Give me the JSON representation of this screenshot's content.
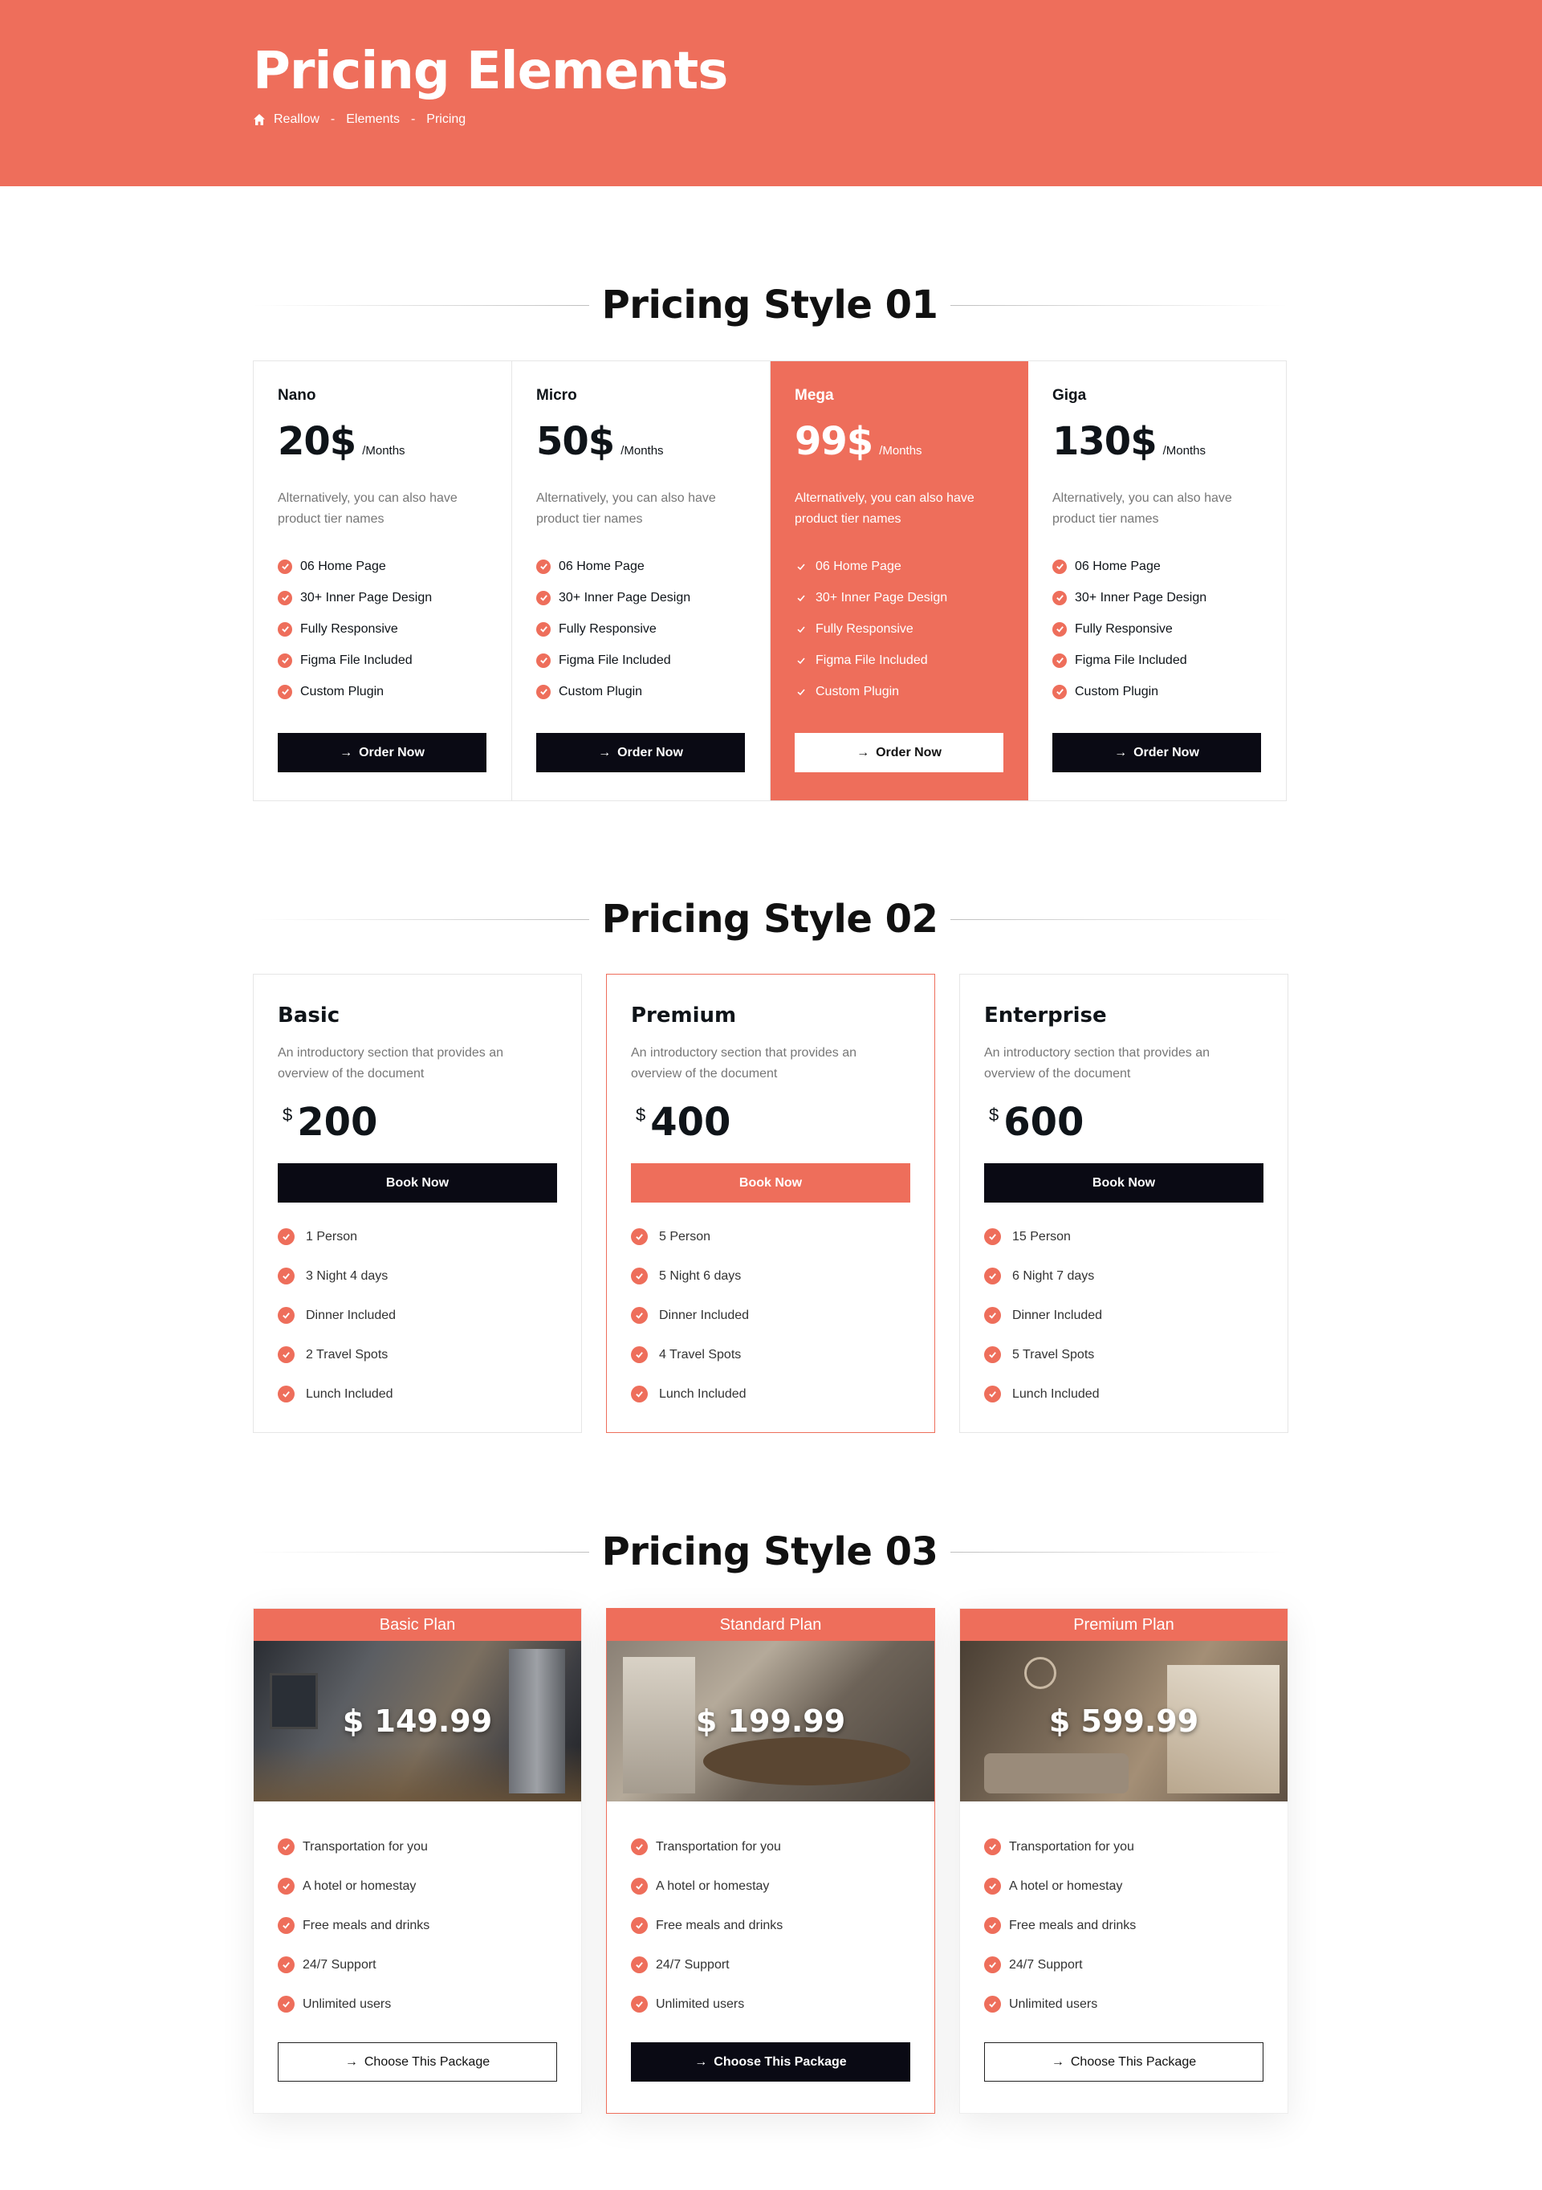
{
  "hero": {
    "title": "Pricing Elements",
    "breadcrumb": [
      "Reallow",
      "Elements",
      "Pricing"
    ],
    "separator": "-"
  },
  "colors": {
    "accent": "#ee6e5b",
    "dark": "#0a0a14"
  },
  "style1": {
    "heading": "Pricing Style 01",
    "cards": [
      {
        "tier": "Nano",
        "amount": "20$",
        "period": "/Months",
        "desc": "Alternatively, you can also have product tier names",
        "features": [
          "06 Home Page",
          "30+ Inner Page Design",
          "Fully Responsive",
          "Figma File Included",
          "Custom Plugin"
        ],
        "button": "Order Now"
      },
      {
        "tier": "Micro",
        "amount": "50$",
        "period": "/Months",
        "desc": "Alternatively, you can also have product tier names",
        "features": [
          "06 Home Page",
          "30+ Inner Page Design",
          "Fully Responsive",
          "Figma File Included",
          "Custom Plugin"
        ],
        "button": "Order Now"
      },
      {
        "tier": "Mega",
        "amount": "99$",
        "period": "/Months",
        "desc": "Alternatively, you can also have product tier names",
        "features": [
          "06 Home Page",
          "30+ Inner Page Design",
          "Fully Responsive",
          "Figma File Included",
          "Custom Plugin"
        ],
        "button": "Order Now"
      },
      {
        "tier": "Giga",
        "amount": "130$",
        "period": "/Months",
        "desc": "Alternatively, you can also have product tier names",
        "features": [
          "06 Home Page",
          "30+ Inner Page Design",
          "Fully Responsive",
          "Figma File Included",
          "Custom Plugin"
        ],
        "button": "Order Now"
      }
    ]
  },
  "style2": {
    "heading": "Pricing Style 02",
    "cards": [
      {
        "name": "Basic",
        "desc": "An introductory section that provides an overview of the document",
        "currency": "$",
        "amount": "200",
        "button": "Book Now",
        "features": [
          "1 Person",
          "3 Night 4 days",
          "Dinner Included",
          "2 Travel Spots",
          "Lunch Included"
        ]
      },
      {
        "name": "Premium",
        "desc": "An introductory section that provides an overview of the document",
        "currency": "$",
        "amount": "400",
        "button": "Book Now",
        "features": [
          "5 Person",
          "5 Night 6 days",
          "Dinner Included",
          "4 Travel Spots",
          "Lunch Included"
        ]
      },
      {
        "name": "Enterprise",
        "desc": "An introductory section that provides an overview of the document",
        "currency": "$",
        "amount": "600",
        "button": "Book Now",
        "features": [
          "15 Person",
          "6 Night 7 days",
          "Dinner Included",
          "5 Travel Spots",
          "Lunch Included"
        ]
      }
    ]
  },
  "style3": {
    "heading": "Pricing Style 03",
    "cards": [
      {
        "plan": "Basic Plan",
        "price": "$ 149.99",
        "features": [
          "Transportation for you",
          "A hotel or homestay",
          "Free meals and drinks",
          "24/7 Support",
          "Unlimited users"
        ],
        "button": "Choose This Package"
      },
      {
        "plan": "Standard Plan",
        "price": "$ 199.99",
        "features": [
          "Transportation for you",
          "A hotel or homestay",
          "Free meals and drinks",
          "24/7 Support",
          "Unlimited users"
        ],
        "button": "Choose This Package"
      },
      {
        "plan": "Premium Plan",
        "price": "$ 599.99",
        "features": [
          "Transportation for you",
          "A hotel or homestay",
          "Free meals and drinks",
          "24/7 Support",
          "Unlimited users"
        ],
        "button": "Choose This Package"
      }
    ]
  }
}
